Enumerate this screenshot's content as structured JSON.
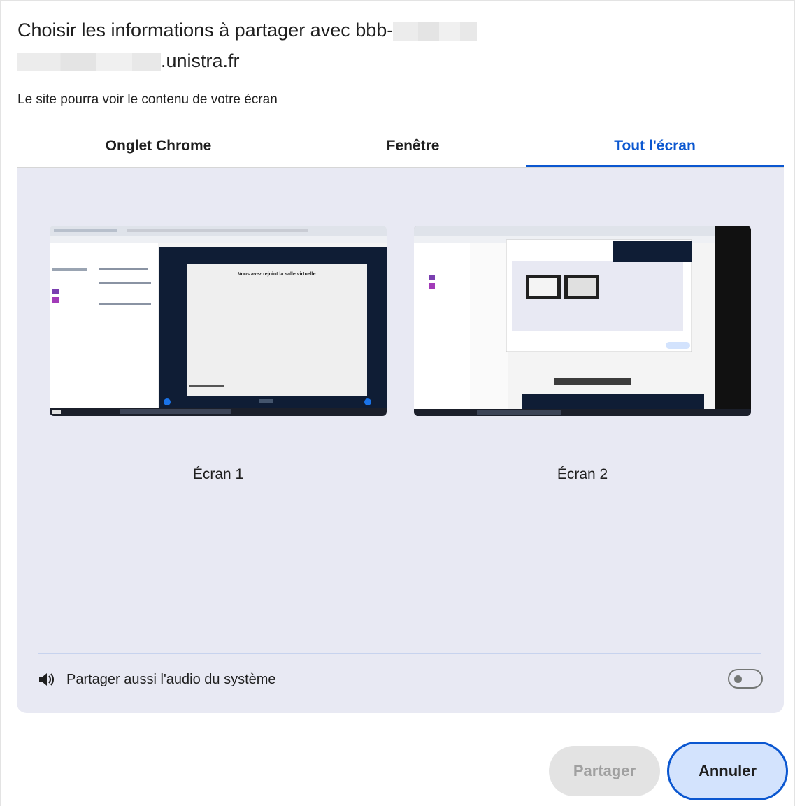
{
  "dialog": {
    "title_line1_prefix": "Choisir les informations à partager avec bbb-",
    "title_line2_suffix": ".unistra.fr",
    "subtitle": "Le site pourra voir le contenu de votre écran"
  },
  "tabs": [
    {
      "label": "Onglet Chrome",
      "active": false
    },
    {
      "label": "Fenêtre",
      "active": false
    },
    {
      "label": "Tout l'écran",
      "active": true
    }
  ],
  "screens": [
    {
      "label": "Écran 1",
      "preview_heading": "Vous avez rejoint la salle virtuelle"
    },
    {
      "label": "Écran 2"
    }
  ],
  "audio": {
    "icon": "speaker-icon",
    "label": "Partager aussi l'audio du système",
    "enabled": false
  },
  "buttons": {
    "share": "Partager",
    "cancel": "Annuler"
  },
  "colors": {
    "accent": "#0b57d0",
    "panel_bg": "#e8e9f3",
    "cancel_bg": "#d3e3fd",
    "share_disabled_bg": "#e3e3e3"
  }
}
